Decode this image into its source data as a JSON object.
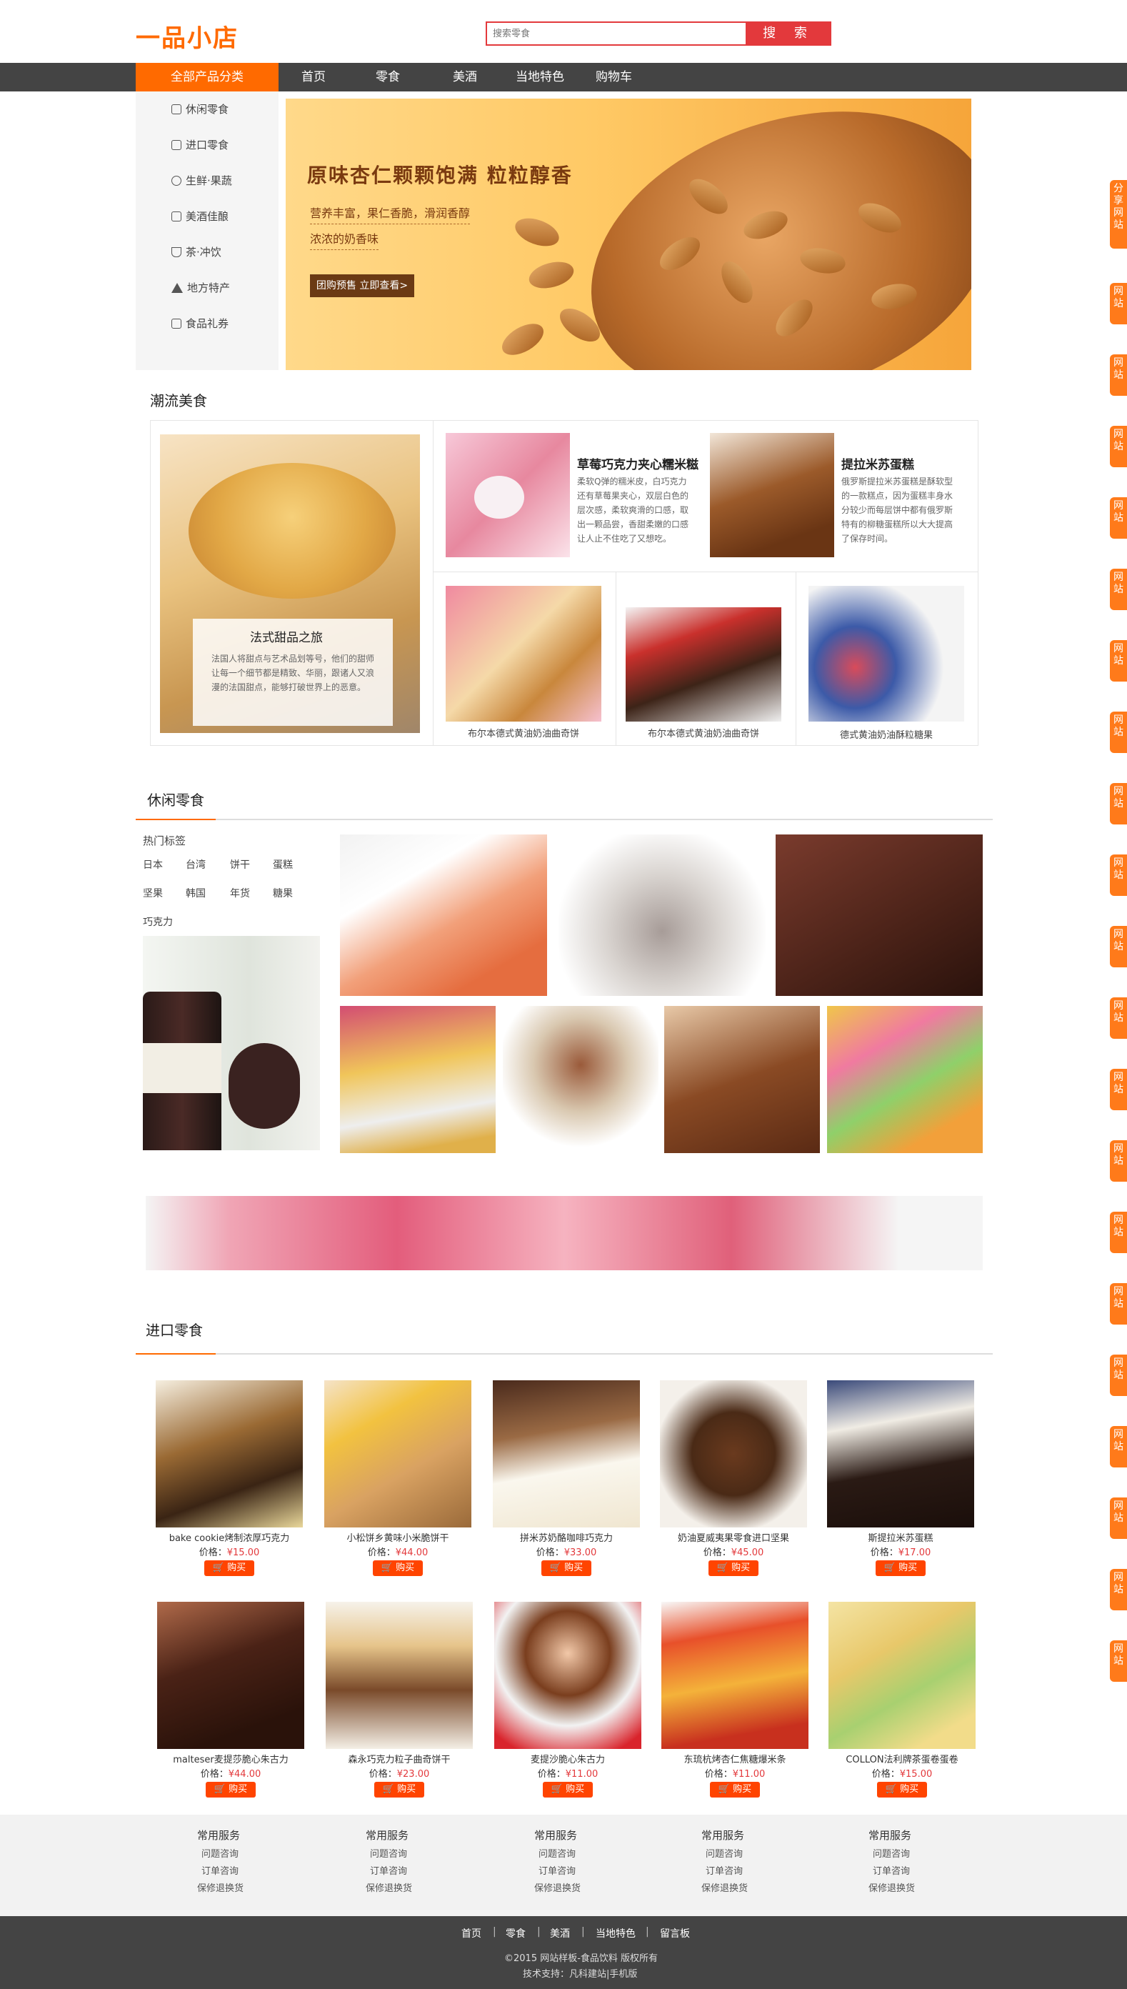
{
  "header": {
    "logo": "一品小店",
    "search_placeholder": "搜索零食",
    "search_button": "搜 索"
  },
  "nav": {
    "category_label": "全部产品分类",
    "items": [
      "首页",
      "零食",
      "美酒",
      "当地特色",
      "购物车"
    ]
  },
  "sidebar": {
    "items": [
      "休闲零食",
      "进口零食",
      "生鲜·果蔬",
      "美酒佳酿",
      "茶·冲饮",
      "地方特产",
      "食品礼券"
    ]
  },
  "banner": {
    "title": "原味杏仁颗颗饱满 粒粒醇香",
    "subtitle1": "营养丰富，果仁香脆，滑润香醇",
    "subtitle2": "浓浓的奶香味",
    "button": "团购预售 立即查看>"
  },
  "trend": {
    "title": "潮流美食",
    "feature": {
      "title": "法式甜品之旅",
      "desc": "法国人将甜点与艺术品划等号，他们的甜师让每一个细节都是精致、华丽，跟诸人又浪漫的法国甜点，能够打破世界上的恶意。"
    },
    "cards": [
      {
        "title": "草莓巧克力夹心糯米糍",
        "desc": "柔软Q弹的糯米皮，白巧克力还有草莓果夹心，双层白色的层次感，柔软爽滑的口感，取出一颗品尝，香甜柔嫩的口感让人止不住吃了又想吃。"
      },
      {
        "title": "提拉米苏蛋糕",
        "desc": "俄罗斯提拉米苏蛋糕是酥软型的一款糕点，因为蛋糕丰身水分较少而每层饼中都有俄罗斯特有的柳糖蛋糕所以大大提高了保存时间。"
      }
    ],
    "small": [
      {
        "caption": "布尔本德式黄油奶油曲奇饼"
      },
      {
        "caption": "布尔本德式黄油奶油曲奇饼"
      },
      {
        "caption": "德式黄油奶油酥粒糖果"
      }
    ]
  },
  "leisure": {
    "title": "休闲零食",
    "hot_label": "热门标签",
    "tags": [
      "日本",
      "台湾",
      "饼干",
      "蛋糕",
      "坚果",
      "韩国",
      "年货",
      "糖果",
      "巧克力"
    ]
  },
  "imported": {
    "title": "进口零食",
    "price_label": "价格：",
    "buy_label": "购买",
    "products": [
      {
        "name": "bake cookie烤制浓厚巧克力",
        "price": "¥15.00"
      },
      {
        "name": "小松饼乡黄味小米脆饼干",
        "price": "¥44.00"
      },
      {
        "name": "拼米苏奶酪咖啡巧克力",
        "price": "¥33.00"
      },
      {
        "name": "奶油夏威夷果零食进口坚果",
        "price": "¥45.00"
      },
      {
        "name": "斯提拉米苏蛋糕",
        "price": "¥17.00"
      },
      {
        "name": "malteser麦提莎脆心朱古力",
        "price": "¥44.00"
      },
      {
        "name": "森永巧克力粒子曲奇饼干",
        "price": "¥23.00"
      },
      {
        "name": "麦提沙脆心朱古力",
        "price": "¥11.00"
      },
      {
        "name": "东琉杭烤杏仁焦糖爆米条",
        "price": "¥11.00"
      },
      {
        "name": "COLLON法利牌茶蛋卷蛋卷",
        "price": "¥15.00"
      }
    ]
  },
  "footer": {
    "columns": [
      {
        "title": "常用服务",
        "links": [
          "问题咨询",
          "订单咨询",
          "保修退换货"
        ]
      },
      {
        "title": "常用服务",
        "links": [
          "问题咨询",
          "订单咨询",
          "保修退换货"
        ]
      },
      {
        "title": "常用服务",
        "links": [
          "问题咨询",
          "订单咨询",
          "保修退换货"
        ]
      },
      {
        "title": "常用服务",
        "links": [
          "问题咨询",
          "订单咨询",
          "保修退换货"
        ]
      },
      {
        "title": "常用服务",
        "links": [
          "问题咨询",
          "订单咨询",
          "保修退换货"
        ]
      }
    ],
    "bottom_nav": [
      "首页",
      "零食",
      "美酒",
      "当地特色",
      "留言板"
    ],
    "copyright": "©2015 网站样板-食品饮料 版权所有",
    "tech": "技术支持：凡科建站|手机版"
  },
  "share": {
    "first": "分享网站",
    "rest": "网站"
  },
  "colors": {
    "accent": "#ff6a00",
    "search_red": "#e3393c",
    "nav_dark": "#444444",
    "buy_orange": "#ff4400"
  }
}
